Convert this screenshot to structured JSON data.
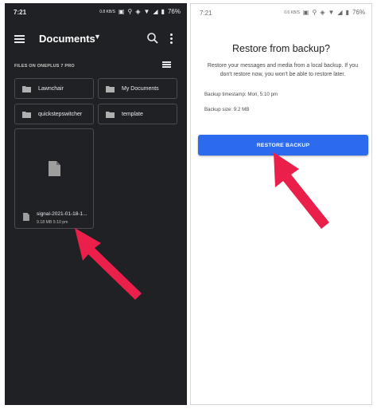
{
  "left_screen": {
    "status_time": "7:21",
    "status_speed": "0.8 KB/S",
    "battery": "76%",
    "title": "Documents",
    "section_label": "FILES ON ONEPLUS 7 PRO",
    "folders": [
      {
        "label": "Lawnchair"
      },
      {
        "label": "My Documents"
      },
      {
        "label": "quickstepswitcher"
      },
      {
        "label": "template"
      }
    ],
    "file": {
      "name": "signal-2021-01-18-1...",
      "meta": "9.18 MB  5:10 pm"
    }
  },
  "right_screen": {
    "status_time": "7:21",
    "status_speed": "0.6 KB/S",
    "battery": "76%",
    "title": "Restore from backup?",
    "description": "Restore your messages and media from a local backup. If you don't restore now, you won't be able to restore later.",
    "backup_timestamp": "Backup timestamp: Mon, 5:10 pm",
    "backup_size": "Backup size: 9.2 MB",
    "restore_button_label": "RESTORE BACKUP"
  },
  "colors": {
    "dark_bg": "#202124",
    "accent_blue": "#2c6bed",
    "arrow_red": "#ea1f4a"
  }
}
